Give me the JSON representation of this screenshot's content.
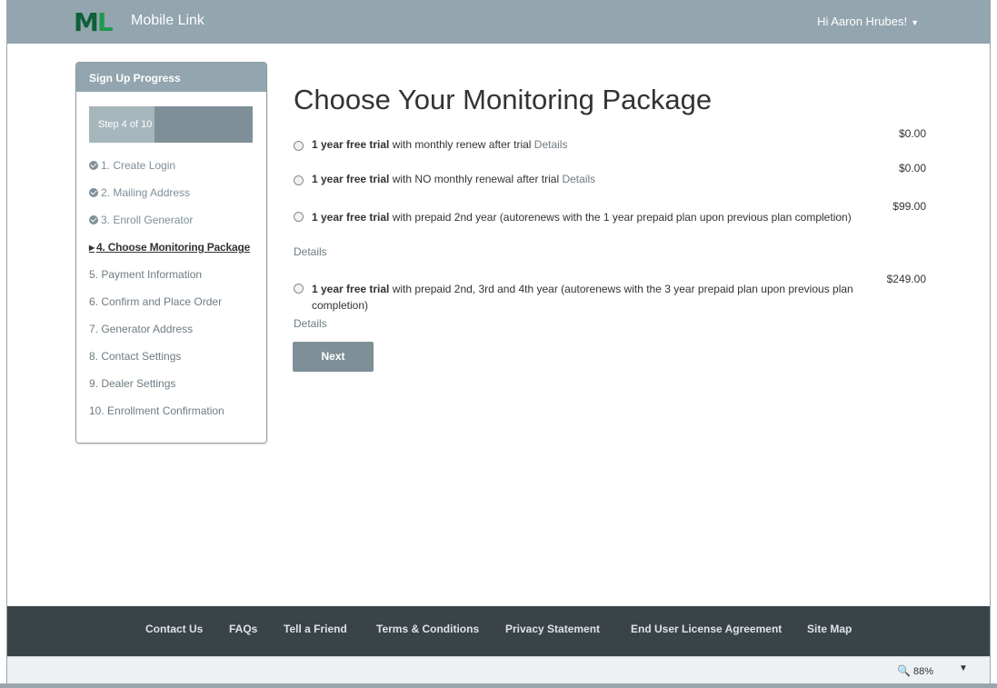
{
  "header": {
    "logo_text_m": "M",
    "logo_text_l": "L",
    "app_name": "Mobile Link",
    "user_greeting": "Hi Aaron Hrubes!"
  },
  "sidebar": {
    "title": "Sign Up Progress",
    "progress_label": "Step 4 of 10",
    "progress_fraction": 0.4,
    "steps": [
      {
        "label": "1. Create Login",
        "state": "done"
      },
      {
        "label": "2. Mailing Address",
        "state": "done"
      },
      {
        "label": "3. Enroll Generator",
        "state": "done"
      },
      {
        "label": "4. Choose Monitoring Package",
        "state": "current"
      },
      {
        "label": "5. Payment Information",
        "state": "pending"
      },
      {
        "label": "6. Confirm and Place Order",
        "state": "pending"
      },
      {
        "label": "7. Generator Address",
        "state": "pending"
      },
      {
        "label": "8. Contact Settings",
        "state": "pending"
      },
      {
        "label": "9. Dealer Settings",
        "state": "pending"
      },
      {
        "label": "10. Enrollment Confirmation",
        "state": "pending"
      }
    ]
  },
  "main": {
    "title": "Choose Your Monitoring Package",
    "options": [
      {
        "text_bold": "1 year free trial",
        "text": " with monthly renew after trial ",
        "details": "Details",
        "price": "$0.00"
      },
      {
        "text_bold": "1 year free trial",
        "text": " with NO monthly renewal after trial ",
        "details": "Details",
        "price": "$0.00"
      },
      {
        "text_bold": "1 year free trial",
        "text": " with prepaid 2nd year (autorenews with the 1 year prepaid plan upon previous plan completion)",
        "details": "Details",
        "price": "$99.00"
      },
      {
        "text_bold": "1 year free trial",
        "text": " with prepaid 2nd, 3rd and 4th year (autorenews with the 3 year prepaid plan upon previous plan completion)",
        "details": "Details",
        "price": "$249.00"
      }
    ],
    "next_label": "Next"
  },
  "footer": {
    "links": [
      "Contact Us",
      "FAQs",
      "Tell a Friend",
      "Terms & Conditions",
      "Privacy Statement",
      "End User License Agreement",
      "Site Map"
    ]
  },
  "statusbar": {
    "zoom": "88%"
  },
  "colors": {
    "header_bg": "#93a5ae",
    "footer_bg": "#3a4347",
    "button_bg": "#7f8f98",
    "logo_dark": "#0f5f38",
    "logo_light": "#1f9a4e"
  }
}
